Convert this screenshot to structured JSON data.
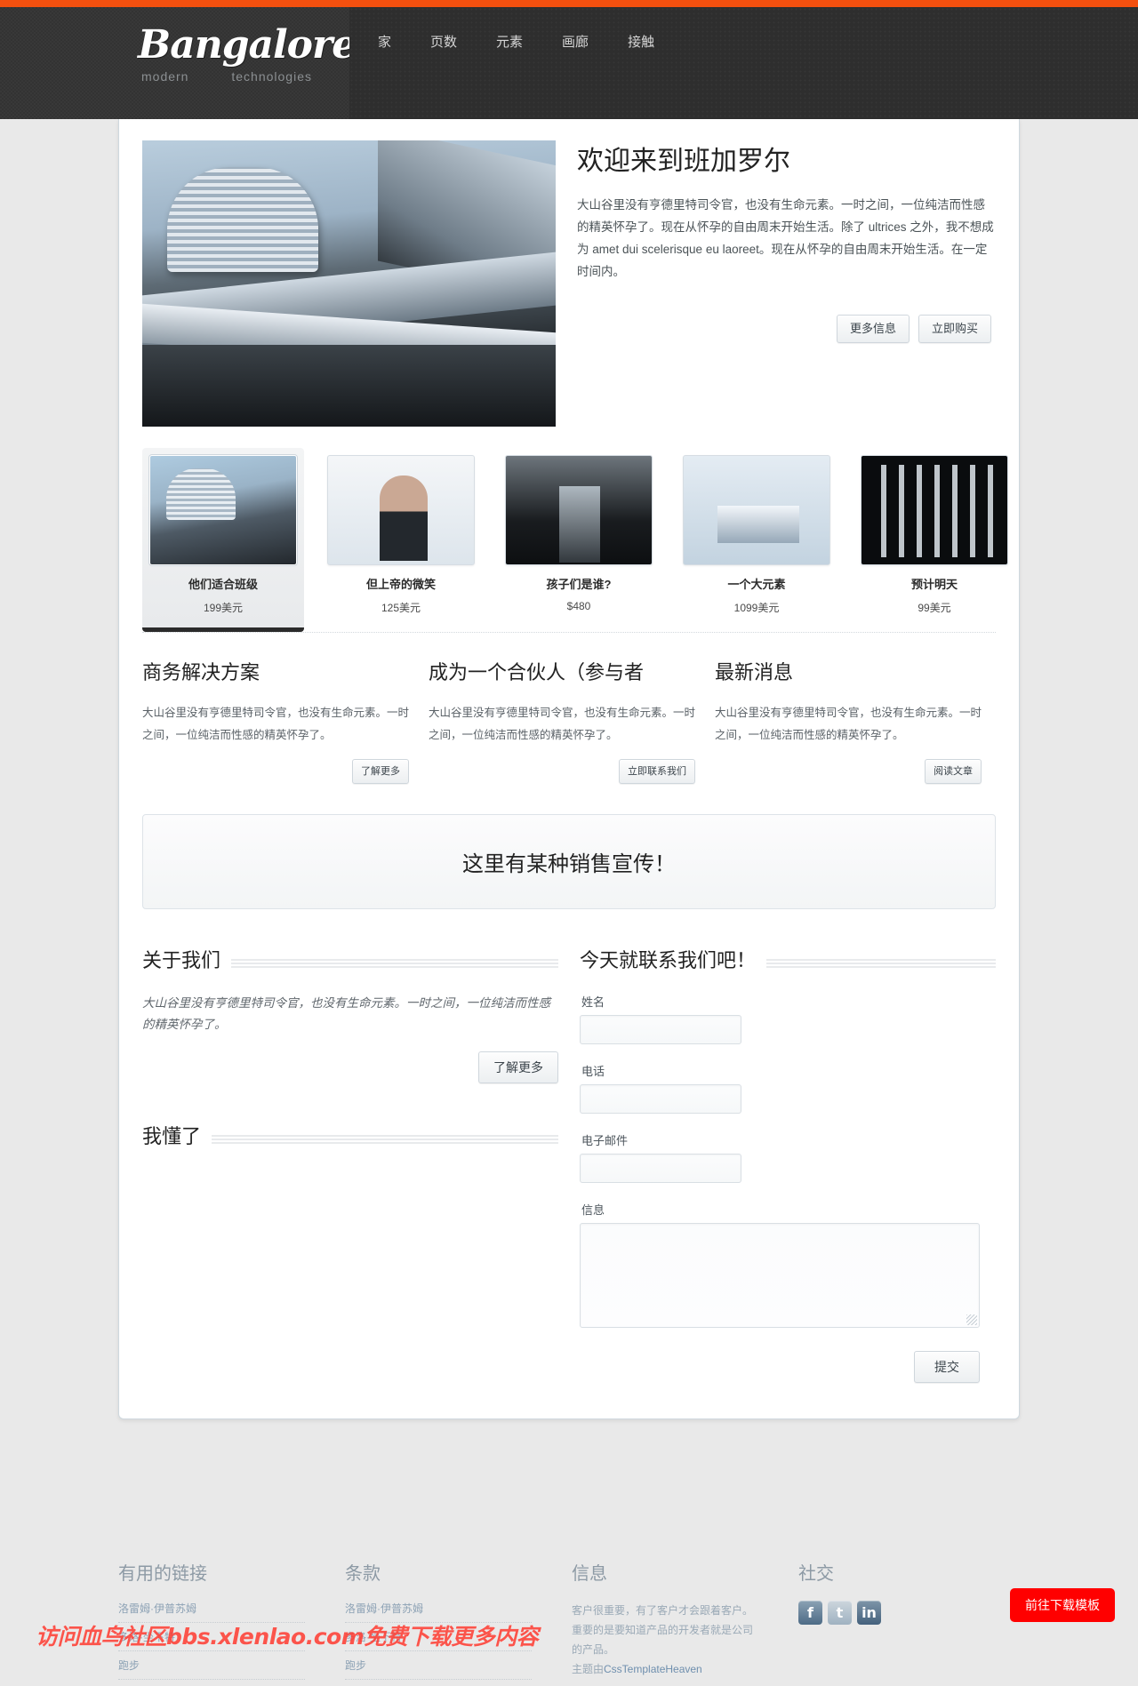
{
  "brand": {
    "name": "Bangalore",
    "tag_left": "modern",
    "tag_right": "technologies"
  },
  "nav": {
    "items": [
      "家",
      "页数",
      "元素",
      "画廊",
      "接触"
    ]
  },
  "hero": {
    "title": "欢迎来到班加罗尔",
    "text": "大山谷里没有亨德里特司令官，也没有生命元素。一时之间，一位纯洁而性感的精英怀孕了。现在从怀孕的自由周末开始生活。除了 ultrices 之外，我不想成为 amet dui scelerisque eu laoreet。现在从怀孕的自由周末开始生活。在一定时间内。",
    "btn_more": "更多信息",
    "btn_buy": "立即购买"
  },
  "thumbs": [
    {
      "caption": "他们适合班级",
      "price": "199美元"
    },
    {
      "caption": "但上帝的微笑",
      "price": "125美元"
    },
    {
      "caption": "孩子们是谁?",
      "price": "$480"
    },
    {
      "caption": "一个大元素",
      "price": "1099美元"
    },
    {
      "caption": "预计明天",
      "price": "99美元"
    }
  ],
  "columns": [
    {
      "title": "商务解决方案",
      "text": "大山谷里没有亨德里特司令官，也没有生命元素。一时之间，一位纯洁而性感的精英怀孕了。",
      "button": "了解更多"
    },
    {
      "title": "成为一个合伙人（参与者",
      "text": "大山谷里没有亨德里特司令官，也没有生命元素。一时之间，一位纯洁而性感的精英怀孕了。",
      "button": "立即联系我们"
    },
    {
      "title": "最新消息",
      "text": "大山谷里没有亨德里特司令官，也没有生命元素。一时之间，一位纯洁而性感的精英怀孕了。",
      "button": "阅读文章"
    }
  ],
  "promo": {
    "text": "这里有某种销售宣传！"
  },
  "about": {
    "title": "关于我们",
    "text": "大山谷里没有亨德里特司令官，也没有生命元素。一时之间，一位纯洁而性感的精英怀孕了。",
    "button": "了解更多",
    "gallery_title": "我懂了"
  },
  "contact": {
    "title": "今天就联系我们吧！",
    "name_label": "姓名",
    "name_value": "",
    "phone_label": "电话",
    "phone_value": "",
    "email_label": "电子邮件",
    "email_value": "",
    "message_label": "信息",
    "message_value": "",
    "submit": "提交"
  },
  "footer": {
    "columns": [
      {
        "title": "有用的链接",
        "links": [
          "洛雷姆·伊普苏姆",
          "多洛·坐下特",
          "跑步"
        ]
      },
      {
        "title": "条款",
        "links": [
          "洛雷姆·伊普苏姆",
          "多洛·坐下特",
          "跑步"
        ]
      }
    ],
    "info": {
      "title": "信息",
      "text": "客户很重要，有了客户才会跟着客户。重要的是要知道产品的开发者就是公司的产品。",
      "credit_prefix": "主题由",
      "credit_brand": "CssTemplateHeaven"
    },
    "social": {
      "title": "社交",
      "icons": [
        "facebook-icon",
        "twitter-icon",
        "linkedin-icon"
      ],
      "glyphs": [
        "f",
        "t",
        "in"
      ]
    }
  },
  "overlay": {
    "watermark": "访问血鸟社区bbs.xlenlao.com免费下载更多内容",
    "download_button": "前往下载模板"
  },
  "colors": {
    "accent": "#f4500f",
    "header": "#333333",
    "download": "#ff0000"
  }
}
